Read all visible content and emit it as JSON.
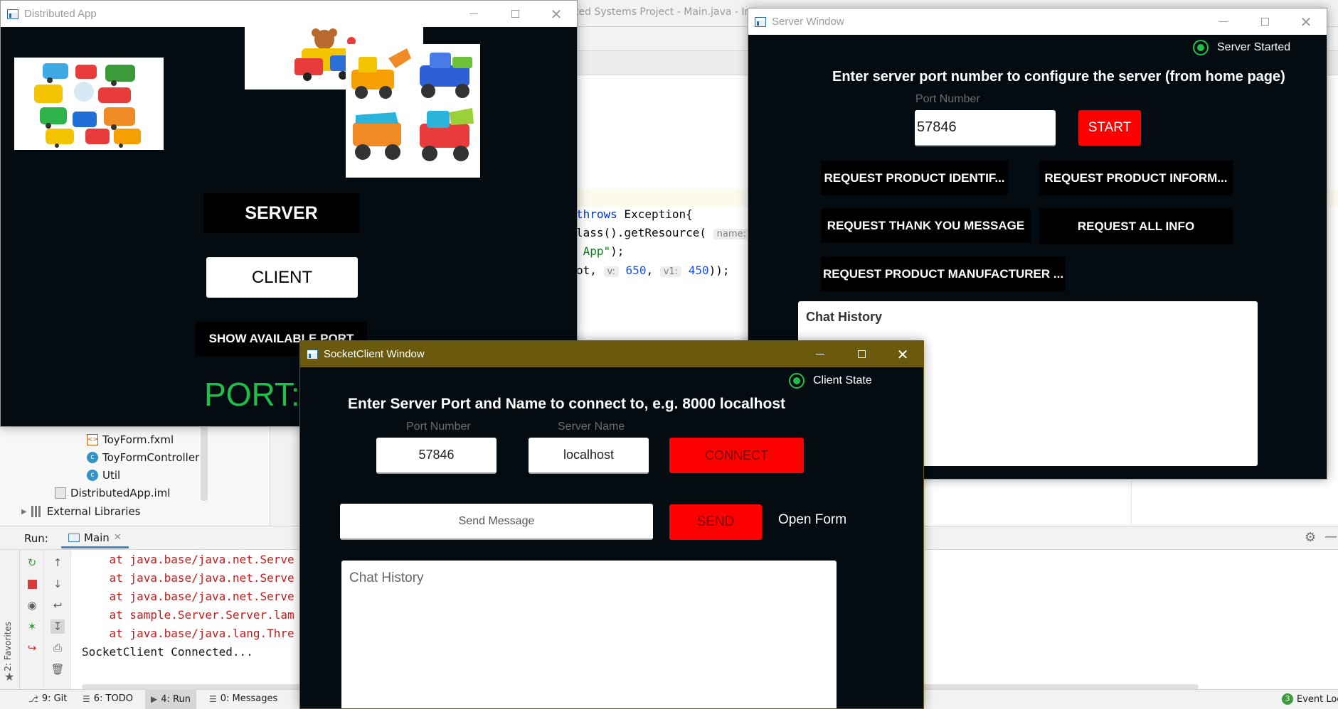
{
  "ide": {
    "title_fragment": "ted Systems Project - Main.java - Int",
    "code_line_1": {
      "keyword": "throws",
      "rest": " Exception{"
    },
    "code_line_2": {
      "text": "lass().getResource(",
      "hint": "name:"
    },
    "code_line_3": {
      "string": " App\"",
      "rest": ");"
    },
    "code_line_4": {
      "text": "ot, ",
      "hint_v": "v:",
      "num_v": "650",
      "sep": ", ",
      "hint_v1": "v1:",
      "num_v1": "450",
      "rest": "));"
    },
    "project_tree": {
      "items": [
        {
          "label": "ToyForm.fxml",
          "icon": "fxml-file-icon"
        },
        {
          "label": "ToyFormController",
          "icon": "class-icon"
        },
        {
          "label": "Util",
          "icon": "class-icon"
        },
        {
          "label": "DistributedApp.iml",
          "icon": "iml-file-icon"
        },
        {
          "label": "External Libraries",
          "icon": "library-icon"
        }
      ]
    },
    "run_panel": {
      "label": "Run:",
      "tab": "Main",
      "console": [
        {
          "text": "    at java.base/java.net.Serve",
          "kind": "err"
        },
        {
          "text": "    at java.base/java.net.Serve",
          "kind": "err"
        },
        {
          "text": "    at java.base/java.net.Serve",
          "kind": "err"
        },
        {
          "text": "    at sample.Server.Server.lam",
          "kind": "err"
        },
        {
          "text": "    at java.base/java.lang.Thre",
          "kind": "err"
        },
        {
          "text": "SocketClient Connected...",
          "kind": "ok"
        }
      ],
      "favorites_label": "2: Favorites"
    },
    "status_bar": {
      "items": [
        "9: Git",
        "6: TODO",
        "4: Run",
        "0: Messages"
      ],
      "active": "4: Run",
      "event_log": "Event Log",
      "event_count": "3"
    }
  },
  "distributed_app": {
    "title": "Distributed App",
    "server_button": "SERVER",
    "client_button": "CLIENT",
    "show_port_button": "SHOW AVAILABLE PORT",
    "port_label": "PORT:"
  },
  "server_window": {
    "title": "Server Window",
    "status_label": "Server Started",
    "heading": "Enter server port number to configure the server (from home page)",
    "port_field_label": "Port Number",
    "port_value": "57846",
    "start_button": "START",
    "buttons": [
      "REQUEST PRODUCT IDENTIF...",
      "REQUEST PRODUCT INFORM...",
      "REQUEST THANK YOU MESSAGE",
      "REQUEST ALL INFO",
      "REQUEST PRODUCT MANUFACTURER ..."
    ],
    "chat_history_label": "Chat History"
  },
  "client_window": {
    "title": "SocketClient Window",
    "status_label": "Client State",
    "heading": "Enter Server Port and Name to connect to, e.g. 8000 localhost",
    "port_field_label": "Port Number",
    "port_value": "57846",
    "server_field_label": "Server Name",
    "server_value": "localhost",
    "connect_button": "CONNECT",
    "message_placeholder": "Send Message",
    "send_button": "SEND",
    "open_form": "Open Form",
    "chat_history_placeholder": "Chat History"
  },
  "colors": {
    "window_bg": "#040c12",
    "accent_green": "#1fbf4a",
    "button_red": "#ff0000",
    "client_titlebar": "#6b5a0d"
  }
}
